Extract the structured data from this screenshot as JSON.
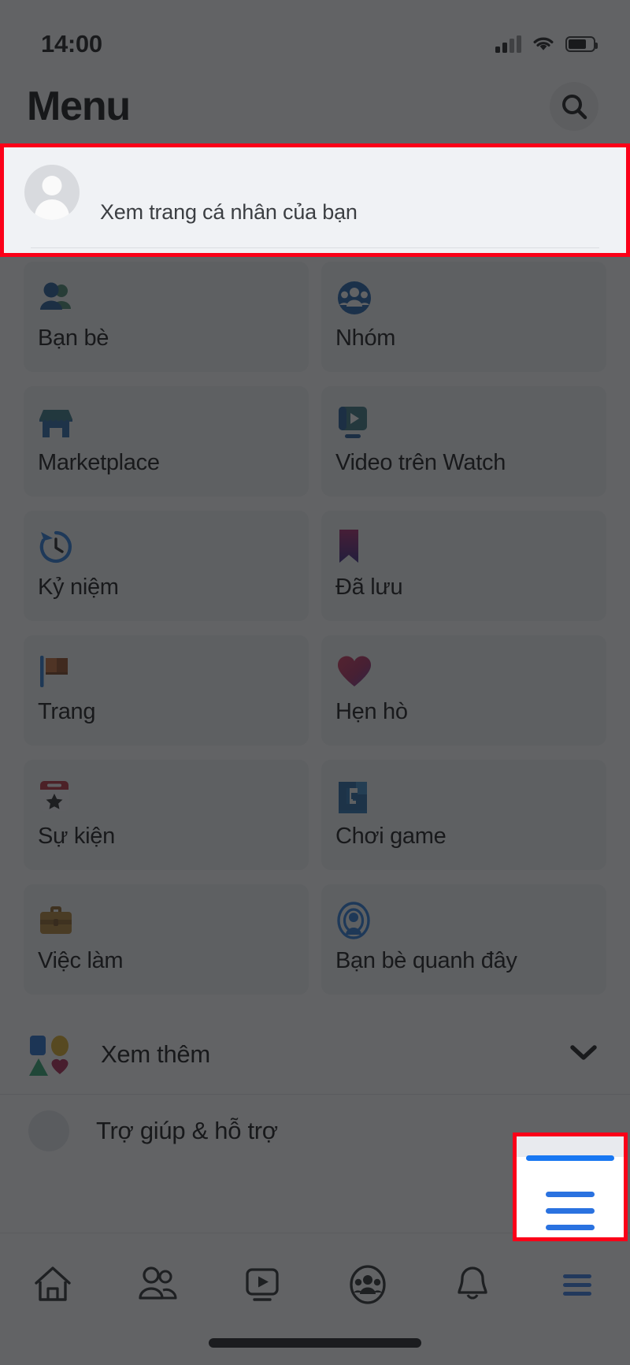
{
  "status_bar": {
    "time": "14:00",
    "signal_icon": "cellular-signal-icon",
    "wifi_icon": "wifi-icon",
    "battery_icon": "battery-icon",
    "battery_level": "74%"
  },
  "header": {
    "title": "Menu",
    "search_icon": "search-icon"
  },
  "profile": {
    "name": "",
    "subtitle": "Xem trang cá nhân của bạn",
    "avatar_icon": "avatar-placeholder-icon"
  },
  "menu_tiles": [
    {
      "label": "Bạn bè",
      "icon": "friends-icon"
    },
    {
      "label": "Nhóm",
      "icon": "groups-icon"
    },
    {
      "label": "Marketplace",
      "icon": "marketplace-icon"
    },
    {
      "label": "Video trên Watch",
      "icon": "watch-video-icon"
    },
    {
      "label": "Kỷ niệm",
      "icon": "memories-clock-icon"
    },
    {
      "label": "Đã lưu",
      "icon": "saved-bookmark-icon"
    },
    {
      "label": "Trang",
      "icon": "pages-flag-icon"
    },
    {
      "label": "Hẹn hò",
      "icon": "dating-heart-icon"
    },
    {
      "label": "Sự kiện",
      "icon": "events-calendar-icon"
    },
    {
      "label": "Chơi game",
      "icon": "gaming-icon"
    },
    {
      "label": "Việc làm",
      "icon": "jobs-briefcase-icon"
    },
    {
      "label": "Bạn bè quanh đây",
      "icon": "nearby-friends-icon"
    }
  ],
  "see_more": {
    "label": "Xem thêm",
    "icon": "shapes-icon",
    "chevron_icon": "chevron-down-icon"
  },
  "peek_row": {
    "label": "Trợ giúp & hỗ trợ"
  },
  "bottom_nav": [
    {
      "icon": "home-icon",
      "active": false
    },
    {
      "icon": "friends-nav-icon",
      "active": false
    },
    {
      "icon": "watch-nav-icon",
      "active": false
    },
    {
      "icon": "groups-nav-icon",
      "active": false
    },
    {
      "icon": "notifications-bell-icon",
      "active": false
    },
    {
      "icon": "hamburger-menu-icon",
      "active": true
    }
  ],
  "annotations": {
    "highlight_color": "#fb0018",
    "boxes": [
      {
        "name": "profile-row-highlight",
        "target": "Xem trang cá nhân của bạn"
      },
      {
        "name": "menu-tab-highlight",
        "target": "hamburger-menu-icon"
      }
    ]
  },
  "colors": {
    "brand_blue": "#1877f2",
    "dim_overlay": "rgba(32,33,36,0.70)",
    "tile_bg": "#f2f3f5",
    "profile_bg": "#f0f2f5"
  }
}
